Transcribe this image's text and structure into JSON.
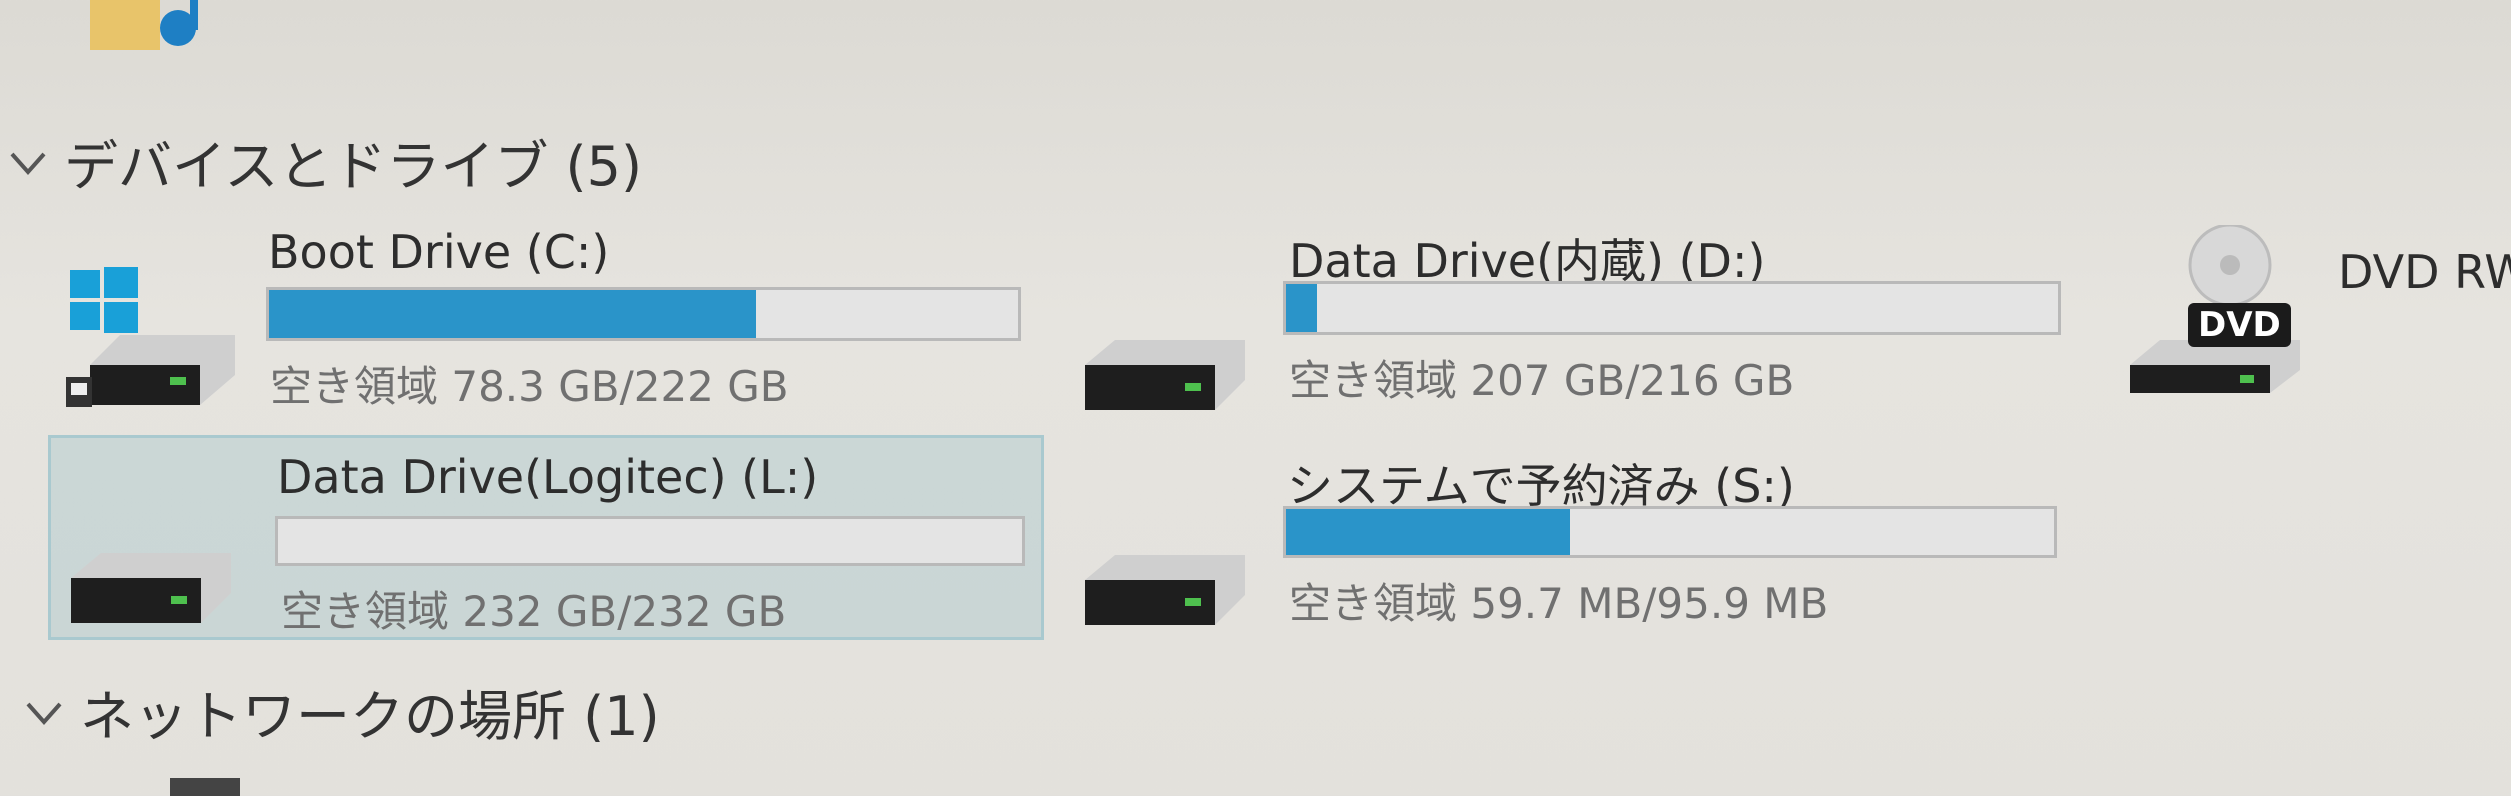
{
  "sections": {
    "devices_header": "デバイスとドライブ (5)",
    "network_header": "ネットワークの場所 (1)"
  },
  "drives": {
    "c": {
      "title": "Boot Drive (C:)",
      "space": "空き領域 78.3 GB/222 GB",
      "used_fraction": 0.65
    },
    "d": {
      "title": "Data Drive(内蔵) (D:)",
      "space": "空き領域 207 GB/216 GB",
      "used_fraction": 0.04
    },
    "l": {
      "title": "Data Drive(Logitec) (L:)",
      "space": "空き領域 232 GB/232 GB",
      "used_fraction": 0.0
    },
    "s": {
      "title": "システムで予約済み (S:)",
      "space": "空き領域 59.7 MB/95.9 MB",
      "used_fraction": 0.37
    },
    "dvd": {
      "title": "DVD RW",
      "badge": "DVD"
    }
  },
  "colors": {
    "bar_fill": "#2a94c9",
    "selection": "#a9c9cf"
  }
}
